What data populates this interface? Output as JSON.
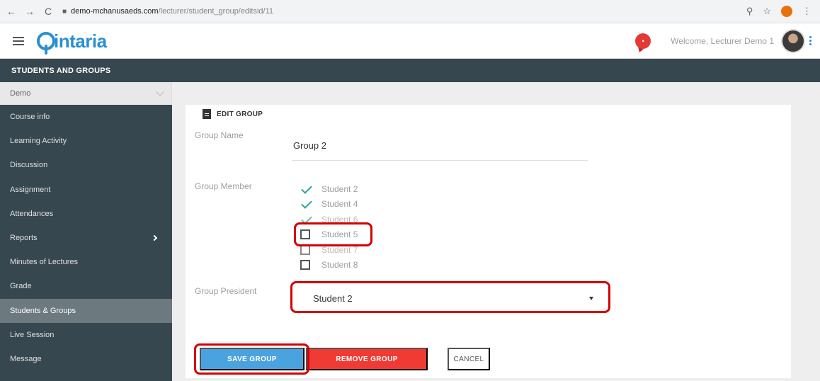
{
  "browser": {
    "url_domain": "demo-mchanusaeds.com",
    "url_path": "/lecturer/student_group/editsid/11"
  },
  "header": {
    "logo_text": "intaria",
    "welcome_text": "Welcome, Lecturer Demo 1"
  },
  "section": {
    "title": "STUDENTS AND GROUPS"
  },
  "course_selector": {
    "value": "Demo"
  },
  "sidebar": {
    "items": [
      {
        "label": "Course info"
      },
      {
        "label": "Learning Activity"
      },
      {
        "label": "Discussion"
      },
      {
        "label": "Assignment"
      },
      {
        "label": "Attendances"
      },
      {
        "label": "Reports"
      },
      {
        "label": "Minutes of Lectures"
      },
      {
        "label": "Grade"
      },
      {
        "label": "Students & Groups"
      },
      {
        "label": "Live Session"
      },
      {
        "label": "Message"
      }
    ]
  },
  "form": {
    "title": "EDIT GROUP",
    "group_name_label": "Group Name",
    "group_name_value": "Group 2",
    "group_member_label": "Group Member",
    "members": [
      {
        "name": "Student 2",
        "checked": true
      },
      {
        "name": "Student 4",
        "checked": true
      },
      {
        "name": "Student 6",
        "checked": true
      },
      {
        "name": "Student 5",
        "checked": false
      },
      {
        "name": "Student 7",
        "checked": false
      },
      {
        "name": "Student 8",
        "checked": false
      }
    ],
    "group_president_label": "Group President",
    "group_president_value": "Student 2",
    "buttons": {
      "save": "SAVE GROUP",
      "remove": "REMOVE GROUP",
      "cancel": "CANCEL"
    }
  },
  "colors": {
    "sidebar_bg": "#37474f",
    "accent_blue": "#4aa3df",
    "danger_red": "#ef3b33",
    "highlight_red": "#d50000",
    "check_teal": "#26a69a"
  }
}
